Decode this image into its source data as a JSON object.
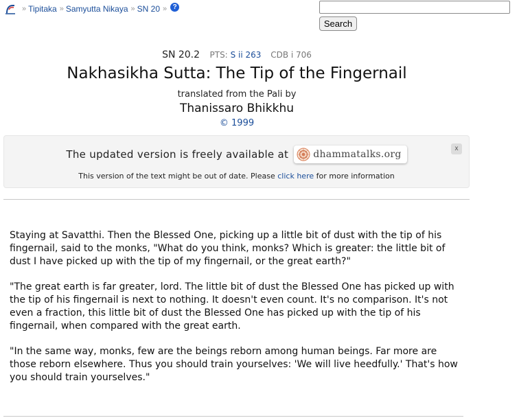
{
  "breadcrumb": {
    "items": [
      "Tipitaka",
      "Samyutta Nikaya",
      "SN 20"
    ],
    "separator": "»"
  },
  "search": {
    "value": "",
    "placeholder": "",
    "button_label": "Search"
  },
  "header": {
    "sutta_ref": "SN 20.2",
    "pts_label": "PTS:",
    "pts_link": "S ii 263",
    "cdb": "CDB i 706",
    "title": "Nakhasikha Sutta: The Tip of the Fingernail",
    "translated_from": "translated from the Pali by",
    "translator": "Thanissaro Bhikkhu",
    "copyright": "© 1999"
  },
  "notice": {
    "main_text": "The updated version is freely available at",
    "badge_text": "dhammatalks.org",
    "close_label": "x",
    "sub_before": "This version of the text might be out of date. Please",
    "sub_link": "click here",
    "sub_after": "for more information"
  },
  "body": {
    "paragraphs": [
      "Staying at Savatthi. Then the Blessed One, picking up a little bit of dust with the tip of his fingernail, said to the monks, \"What do you think, monks? Which is greater: the little bit of dust I have picked up with the tip of my fingernail, or the great earth?\"",
      "\"The great earth is far greater, lord. The little bit of dust the Blessed One has picked up with the tip of his fingernail is next to nothing. It doesn't even count. It's no comparison. It's not even a fraction, this little bit of dust the Blessed One has picked up with the tip of his fingernail, when compared with the great earth.",
      "\"In the same way, monks, few are the beings reborn among human beings. Far more are those reborn elsewhere. Thus you should train yourselves: 'We will live heedfully.' That's how you should train yourselves.\""
    ]
  },
  "icons": {
    "logo": "site-logo-icon",
    "help": "help-icon",
    "badge": "dhammatalks-logo-icon"
  },
  "colors": {
    "link": "#1a4d99",
    "help_badge": "#1f5fd6",
    "notice_bg": "#f4f4f4"
  }
}
